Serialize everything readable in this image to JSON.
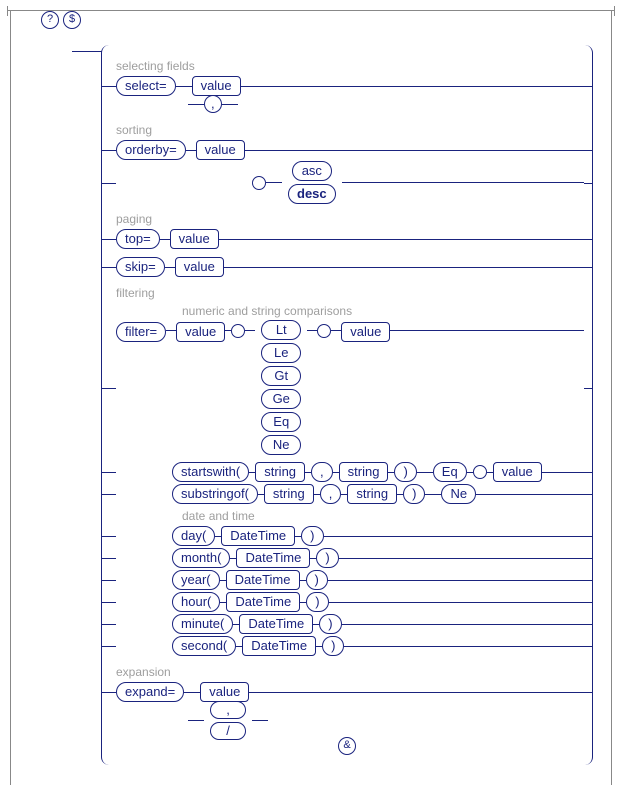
{
  "prefix": {
    "qmark": "?",
    "dollar": "$"
  },
  "sections": {
    "selecting": {
      "label": "selecting fields",
      "keyword": "select=",
      "value": "value",
      "sep": ","
    },
    "sorting": {
      "label": "sorting",
      "keyword": "orderby=",
      "value": "value",
      "asc": "asc",
      "desc": "desc"
    },
    "paging": {
      "label": "paging",
      "top": "top=",
      "skip": "skip=",
      "value": "value"
    },
    "filtering": {
      "label": "filtering",
      "sublabel_numstr": "numeric and string comparisons",
      "keyword": "filter=",
      "value": "value",
      "ops": [
        "Lt",
        "Le",
        "Gt",
        "Ge",
        "Eq",
        "Ne"
      ],
      "startswith": "startswith(",
      "substringof": "substringof(",
      "string": "string",
      "comma": ",",
      "rparen": ")",
      "eq": "Eq",
      "ne": "Ne",
      "sublabel_dt": "date and time",
      "dt_funcs": [
        "day(",
        "month(",
        "year(",
        "hour(",
        "minute(",
        "second("
      ],
      "datetime": "DateTime"
    },
    "expansion": {
      "label": "expansion",
      "keyword": "expand=",
      "value": "value",
      "sep1": ",",
      "sep2": "/"
    }
  },
  "joiner": "&"
}
